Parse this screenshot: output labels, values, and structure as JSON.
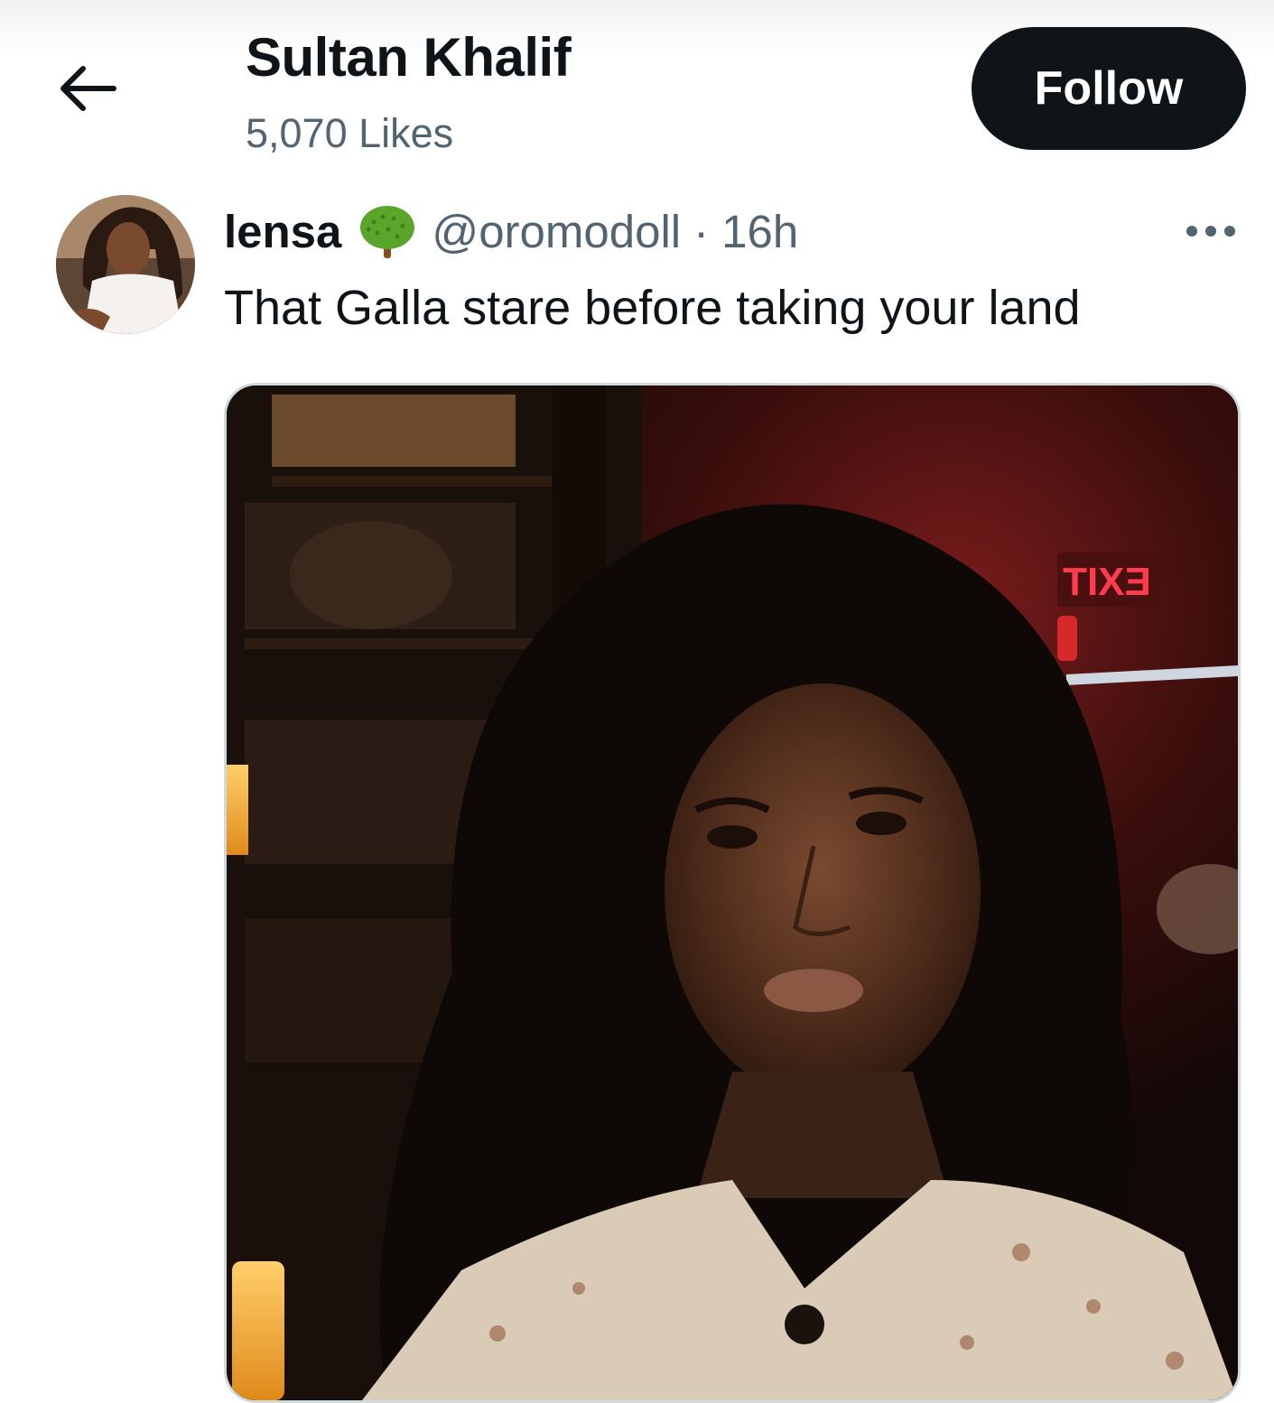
{
  "header": {
    "back_icon": "arrow-left-icon",
    "title": "Sultan Khalif",
    "subtitle": "5,070 Likes",
    "follow_label": "Follow"
  },
  "tweet": {
    "avatar_icon": "avatar",
    "display_name": "lensa",
    "badge_icon": "tree-emoji-icon",
    "handle": "@oromodoll",
    "separator": "·",
    "time": "16h",
    "more_icon": "more-options-icon",
    "text": "That Galla stare before taking your land",
    "media": {
      "sign_text": "EXIT"
    }
  },
  "colors": {
    "text_primary": "#0f1419",
    "text_secondary": "#536471",
    "follow_button_bg": "#0f1419",
    "follow_button_text": "#ffffff",
    "media_border": "#cfd9de",
    "exit_sign": "#ff3b4f"
  }
}
